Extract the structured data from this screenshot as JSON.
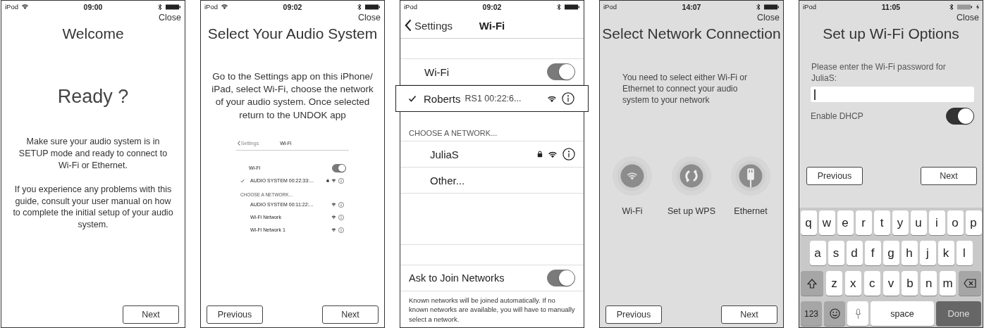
{
  "screens": [
    {
      "kind": "welcome",
      "status_bar": {
        "carrier": "iPod",
        "wifi": true,
        "time": "09:00"
      },
      "close": "Close",
      "title": "Welcome",
      "heading": "Ready ?",
      "paragraphs": [
        "Make sure your audio system is in SETUP mode and ready to connect to Wi-Fi or Ethernet.",
        "If you experience any problems with this guide, consult your user manual on how to complete the initial setup of your audio system."
      ],
      "buttons": [
        "Next"
      ]
    },
    {
      "kind": "select_system",
      "status_bar": {
        "carrier": "iPod",
        "wifi": true,
        "time": "09:02"
      },
      "close": "Close",
      "title": "Select Your Audio System",
      "paragraphs": [
        "Go to the Settings app on this iPhone/ iPad, select Wi-Fi, choose the network of your audio system. Once selected return to the UNDOK app"
      ],
      "example": {
        "nav": {
          "back": "Settings",
          "title": "Wi-Fi"
        },
        "wifi_toggle": {
          "label": "Wi-Fi",
          "on": true
        },
        "connected": {
          "name": "AUDIO SYSTEM 00:22:33:...",
          "checked": true,
          "locked": true,
          "wifi": true,
          "info": true
        },
        "section": "CHOOSE A NETWORK...",
        "networks": [
          {
            "name": "AUDIO SYSTEM 00:11:22:...",
            "locked": false,
            "wifi": true,
            "info": true
          },
          {
            "name": "Wi-Fi Network",
            "locked": false,
            "wifi": true,
            "info": true
          },
          {
            "name": "Wi-Fi Network 1",
            "locked": false,
            "wifi": true,
            "info": true
          }
        ]
      },
      "buttons": [
        "Previous",
        "Next"
      ]
    },
    {
      "kind": "wifi_settings",
      "status_bar": {
        "carrier": "iPod",
        "time": "09:02"
      },
      "settings": {
        "nav": {
          "back": "Settings",
          "title": "Wi-Fi"
        },
        "wifi_toggle": {
          "label": "Wi-Fi",
          "on": true
        },
        "connected": {
          "name": "Roberts",
          "detail": "RS1 00:22:6...",
          "checked": true,
          "highlighted": true,
          "locked": false,
          "wifi": true,
          "info": true
        },
        "section": "CHOOSE A NETWORK...",
        "networks": [
          {
            "name": "JuliaS",
            "locked": true,
            "wifi": true,
            "info": true
          },
          {
            "name": "Other...",
            "locked": false,
            "wifi": false,
            "info": false
          }
        ],
        "ask_join": {
          "label": "Ask to Join Networks",
          "on": true
        },
        "footnote": "Known networks will be joined automatically. If no known networks are available, you will have to manually select a network."
      }
    },
    {
      "kind": "network_connection",
      "status_bar": {
        "carrier": "iPod",
        "time": "14:07"
      },
      "close": "Close",
      "title": "Select Network Connection",
      "paragraphs": [
        "You need to select either Wi-Fi or Ethernet to connect your audio system to your network"
      ],
      "options": [
        {
          "kind": "wifi",
          "label": "Wi-Fi"
        },
        {
          "kind": "wps",
          "label": "Set up WPS"
        },
        {
          "kind": "ethernet",
          "label": "Ethernet"
        }
      ],
      "buttons": [
        "Previous",
        "Next"
      ]
    },
    {
      "kind": "wifi_options",
      "status_bar": {
        "carrier": "iPod",
        "time": "11:05",
        "charging": true
      },
      "close": "Close",
      "title": "Set up Wi-Fi Options",
      "prompt": "Please enter the Wi-Fi password for JuliaS:",
      "password_field": {
        "focused": true
      },
      "dhcp": {
        "label": "Enable DHCP",
        "on": true
      },
      "buttons": [
        "Previous",
        "Next"
      ],
      "keyboard": [
        [
          {
            "kind": "letter",
            "label": "q"
          },
          {
            "kind": "letter",
            "label": "w"
          },
          {
            "kind": "letter",
            "label": "e"
          },
          {
            "kind": "letter",
            "label": "r"
          },
          {
            "kind": "letter",
            "label": "t"
          },
          {
            "kind": "letter",
            "label": "y"
          },
          {
            "kind": "letter",
            "label": "u"
          },
          {
            "kind": "letter",
            "label": "i"
          },
          {
            "kind": "letter",
            "label": "o"
          },
          {
            "kind": "letter",
            "label": "p"
          }
        ],
        [
          {
            "kind": "letter",
            "label": "a"
          },
          {
            "kind": "letter",
            "label": "s"
          },
          {
            "kind": "letter",
            "label": "d"
          },
          {
            "kind": "letter",
            "label": "f"
          },
          {
            "kind": "letter",
            "label": "g"
          },
          {
            "kind": "letter",
            "label": "h"
          },
          {
            "kind": "letter",
            "label": "j"
          },
          {
            "kind": "letter",
            "label": "k"
          },
          {
            "kind": "letter",
            "label": "l"
          }
        ],
        [
          {
            "kind": "shift"
          },
          {
            "kind": "letter",
            "label": "z"
          },
          {
            "kind": "letter",
            "label": "x"
          },
          {
            "kind": "letter",
            "label": "c"
          },
          {
            "kind": "letter",
            "label": "v"
          },
          {
            "kind": "letter",
            "label": "b"
          },
          {
            "kind": "letter",
            "label": "n"
          },
          {
            "kind": "letter",
            "label": "m"
          },
          {
            "kind": "delete"
          }
        ],
        [
          {
            "kind": "numbers",
            "label": "123"
          },
          {
            "kind": "emoji"
          },
          {
            "kind": "mic"
          },
          {
            "kind": "space",
            "label": "space"
          },
          {
            "kind": "done",
            "label": "Done"
          }
        ]
      ]
    }
  ]
}
